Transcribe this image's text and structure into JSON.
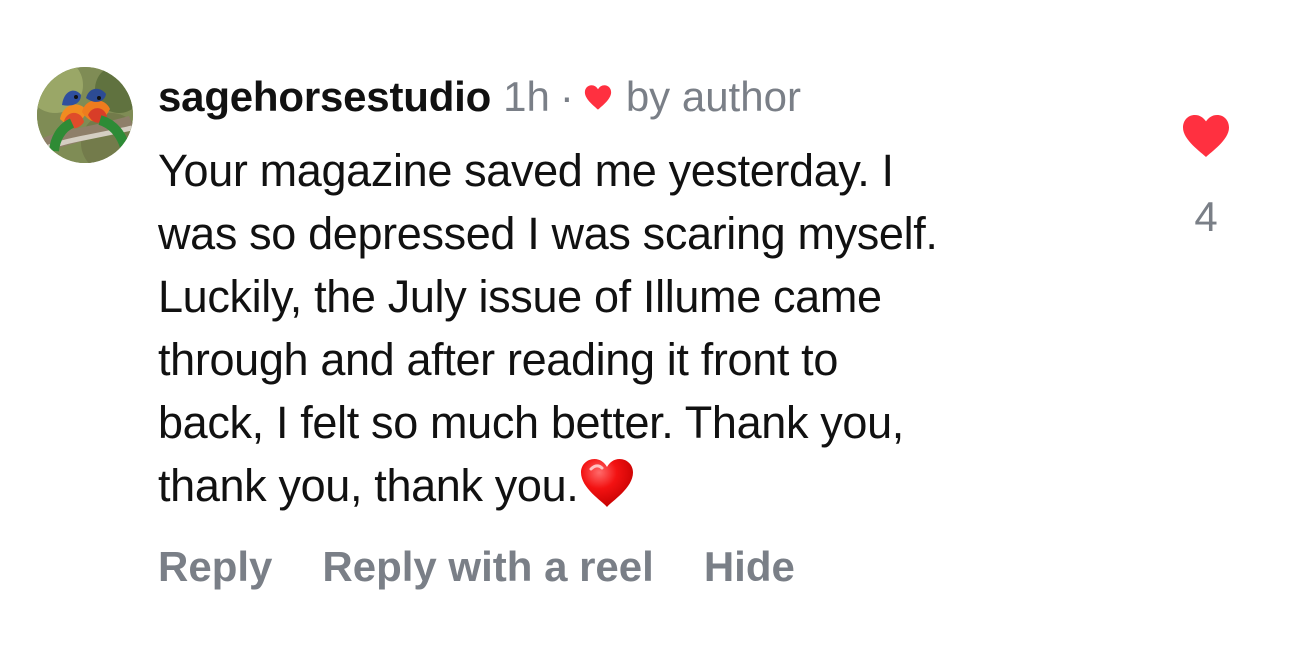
{
  "comment": {
    "username": "sagehorsestudio",
    "time": "1h",
    "dot": "·",
    "liked_by_author_label": "by author",
    "text_lines": [
      "Your magazine saved me yesterday. I",
      "was so depressed I was scaring myself.",
      "Luckily, the July issue of Illume came",
      "through and after reading it front to",
      "back, I felt so much better. Thank you,",
      "thank you, thank you."
    ],
    "like_count": "4",
    "actions": {
      "reply": "Reply",
      "reply_with_reel": "Reply with a reel",
      "hide": "Hide"
    },
    "icons": {
      "author_like": "heart-icon",
      "like": "heart-icon",
      "emoji": "red-heart-emoji-icon"
    },
    "colors": {
      "heart_red": "#ff3040",
      "muted_text": "#7a7f87",
      "primary_text": "#111111"
    }
  }
}
